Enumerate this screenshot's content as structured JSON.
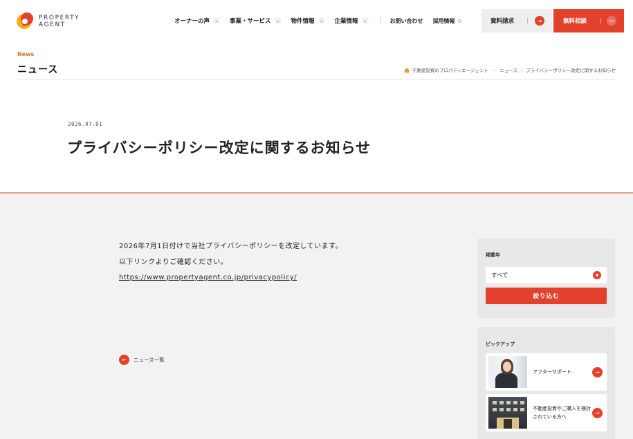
{
  "header": {
    "logo_line1": "PROPERTY",
    "logo_line2": "AGENT",
    "nav": [
      {
        "label": "オーナーの声"
      },
      {
        "label": "事業・サービス"
      },
      {
        "label": "物件情報"
      },
      {
        "label": "企業情報"
      }
    ],
    "nav_small": [
      {
        "label": "お問い合わせ"
      },
      {
        "label": "採用情報"
      }
    ],
    "doc_button": "資料請求",
    "consult_button": "無料相談",
    "accent_color": "#e3412b"
  },
  "page": {
    "section_en": "News",
    "section_jp": "ニュース",
    "breadcrumb": [
      "不動産投資のプロパティエージェント",
      "ニュース",
      "プライバシーポリシー改定に関するお知らせ"
    ],
    "date": "2026.07.01",
    "title": "プライバシーポリシー改定に関するお知らせ"
  },
  "article": {
    "line1": "2026年7月1日付けで当社プライバシーポリシーを改定しています。",
    "line2": "以下リンクよりご確認ください。",
    "link": "https://www.propertyagent.co.jp/privacypolicy/",
    "back_label": "ニュース一覧"
  },
  "sidebar": {
    "filter_label": "掲載年",
    "select_value": "すべて",
    "filter_button": "絞り込む",
    "pickup_label": "ピックアップ",
    "pickups": [
      {
        "label": "アフターサポート",
        "image": "support-woman-photo"
      },
      {
        "label": "不動産投資やご購入を検討されている方へ",
        "image": "building-photo"
      }
    ]
  },
  "icons": {
    "chevron": "chevron-down-icon",
    "arrow_right": "arrow-right-icon",
    "chat": "chat-icon",
    "home": "home-icon",
    "arrow_left": "arrow-left-icon"
  }
}
